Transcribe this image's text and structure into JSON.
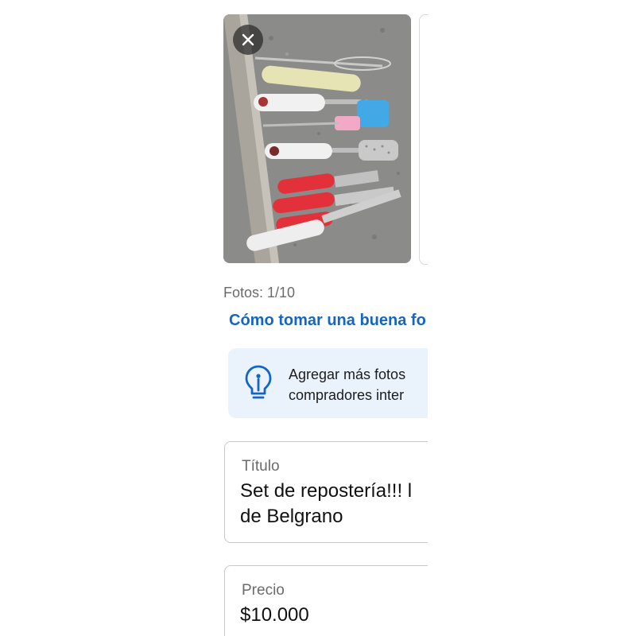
{
  "photos": {
    "close_icon": "close-icon",
    "count_label": "Fotos: 1/10",
    "tips_link": "Cómo tomar una buena fo"
  },
  "tip": {
    "icon": "lightbulb-icon",
    "line1": "Agregar más fotos",
    "line2": "compradores inter"
  },
  "title_field": {
    "label": "Título",
    "value_line1": "Set de repostería!!! l",
    "value_line2": "de Belgrano"
  },
  "price_field": {
    "label": "Precio",
    "value": "$10.000"
  },
  "colors": {
    "link": "#1466c4",
    "tip_background": "#eaf3fc",
    "field_border": "#c9c9c9"
  }
}
